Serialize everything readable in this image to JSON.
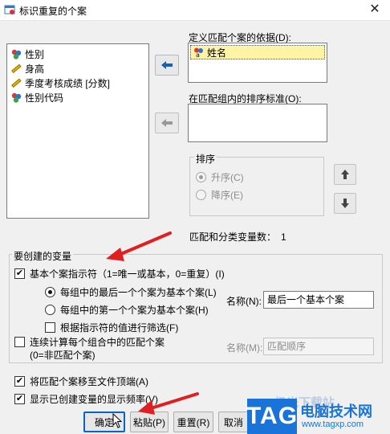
{
  "window": {
    "title": "标识重复的个案",
    "close_glyph": "✕"
  },
  "variables": {
    "items": [
      {
        "label": "性别",
        "icon": "nominal-icon"
      },
      {
        "label": "身高",
        "icon": "scale-ruler-icon"
      },
      {
        "label": "季度考核成绩 [分数]",
        "icon": "scale-ruler-icon"
      },
      {
        "label": "性别代码",
        "icon": "nominal-icon"
      }
    ]
  },
  "match_cases": {
    "label": "定义匹配个案的依据(D):",
    "items": [
      {
        "label": "姓名",
        "icon": "string-nominal-icon"
      }
    ]
  },
  "sort_within": {
    "label": "在匹配组内的排序标准(O):"
  },
  "sort_order": {
    "group_label": "排序",
    "ascending": "升序(C)",
    "descending": "降序(E)"
  },
  "match_count": {
    "label": "匹配和分类变量数：",
    "value": "1"
  },
  "create_vars": {
    "group_label": "要创建的变量",
    "primary_indicator": "基本个案指示符（1=唯一或基本，0=重复）(I)",
    "last_case": "每组中的最后一个个案为基本个案(L)",
    "first_case": "每组中的第一个个案为基本个案(H)",
    "filter_by_indicator": "根据指示符的值进行筛选(F)",
    "name_label": "名称(N):",
    "name_value": "最后一个基本个案",
    "sequential_count": "连续计算每个组合中的匹配个案",
    "sequential_count_sub": "(0=非匹配个案)",
    "name2_label": "名称(M):",
    "name2_value": "匹配顺序"
  },
  "options": {
    "move_to_top": "将匹配个案移至文件顶端(A)",
    "show_frequency": "显示已创建变量的显示频率(V)"
  },
  "buttons": {
    "ok": "确定",
    "paste": "粘贴(P)",
    "reset": "重置(R)",
    "cancel": "取消"
  },
  "watermark": {
    "logo": "TAG",
    "site_name": "电脑技术网",
    "url": "www.tagxp.com",
    "faded_text": "极光下载站"
  },
  "colors": {
    "accent": "#0a64c8",
    "annotation_arrow": "#e02020",
    "selection": "#fff3a6",
    "watermark": "#1a73d9"
  }
}
